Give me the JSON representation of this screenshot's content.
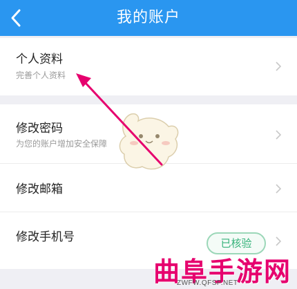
{
  "header": {
    "title": "我的账户",
    "back_icon": "chevron-left-icon"
  },
  "rows": [
    {
      "title": "个人资料",
      "subtitle": "完善个人资料"
    },
    {
      "title": "修改密码",
      "subtitle": "为您的账户增加安全保障"
    },
    {
      "title": "修改邮箱"
    },
    {
      "title": "修改手机号",
      "badge": "已核验"
    }
  ],
  "watermark": {
    "brand": "曲阜手游网",
    "url": "ZWFW.QFSP.NET"
  },
  "colors": {
    "header": "#2a96f0",
    "arrow": "#e6006e",
    "badge": "#35b27a"
  }
}
